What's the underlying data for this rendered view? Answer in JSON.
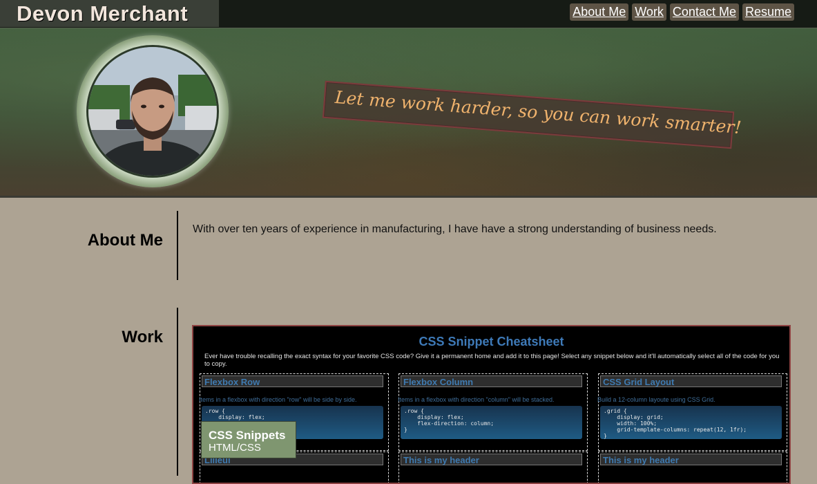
{
  "header": {
    "brand": "Devon Merchant",
    "nav": [
      "About Me",
      "Work",
      "Contact Me",
      "Resume"
    ]
  },
  "hero": {
    "tagline": "Let me work harder, so you can work smarter!"
  },
  "about": {
    "heading": "About Me",
    "text": "With over ten years of experience in manufacturing, I have have a strong understanding of business needs."
  },
  "work": {
    "heading": "Work",
    "project": {
      "title": "CSS Snippet Cheatsheet",
      "description": "Ever have trouble recalling the exact syntax for your favorite CSS code? Give it a permanent home and add it to this page! Select any snippet below and it'll automatically select all of the code for you to copy.",
      "snippets": [
        {
          "title": "Flexbox Row",
          "desc": "Items in a flexbox with direction \"row\" will be side by side.",
          "code": ".row {\n    display: flex;\n}"
        },
        {
          "title": "Flexbox Column",
          "desc": "Items in a flexbox with direction \"column\" will be stacked.",
          "code": ".row {\n    display: flex;\n    flex-direction: column;\n}"
        },
        {
          "title": "CSS Grid Layout",
          "desc": "Build a 12-column layoute using CSS Grid.",
          "code": ".grid {\n    display: grid;\n    width: 100%;\n    grid-template-columns: repeat(12, 1fr);\n}"
        },
        {
          "title": "Lilleul",
          "desc": "",
          "code": ""
        },
        {
          "title": "This is my header",
          "desc": "",
          "code": ""
        },
        {
          "title": "This is my header",
          "desc": "",
          "code": ""
        }
      ],
      "label_title": "CSS Snippets",
      "label_subtitle": "HTML/CSS"
    }
  }
}
